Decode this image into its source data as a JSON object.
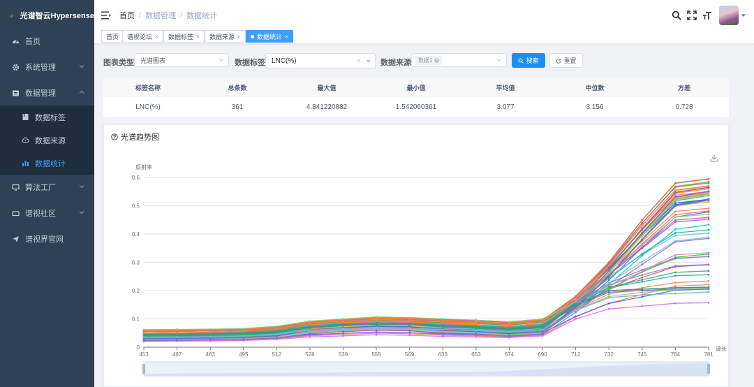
{
  "app": {
    "title": "光谱智云Hypersense"
  },
  "sidebar": {
    "items": [
      {
        "label": "首页",
        "icon": "dashboard-icon"
      },
      {
        "label": "系统管理",
        "icon": "gear-icon"
      },
      {
        "label": "数据管理",
        "icon": "database-icon"
      },
      {
        "label": "算法工厂",
        "icon": "monitor-icon"
      },
      {
        "label": "谱视社区",
        "icon": "community-icon"
      },
      {
        "label": "谱视界官网",
        "icon": "send-icon"
      }
    ],
    "sub_items": [
      {
        "label": "数据标签",
        "icon": "tag-icon"
      },
      {
        "label": "数据来源",
        "icon": "cloud-icon"
      },
      {
        "label": "数据统计",
        "icon": "bar-chart-icon"
      }
    ],
    "active_color": "#409eff",
    "bg_color": "#304156"
  },
  "header": {
    "breadcrumb": [
      "首页",
      "数据管理",
      "数据统计"
    ]
  },
  "tags": [
    {
      "label": "首页"
    },
    {
      "label": "谱视论坛"
    },
    {
      "label": "数据标签"
    },
    {
      "label": "数据来源"
    },
    {
      "label": "数据统计"
    }
  ],
  "filters": {
    "chart_type_label": "图表类型",
    "chart_type_value": "光谱图表",
    "data_tag_label": "数据标签",
    "data_tag_value": "LNC(%)",
    "data_source_label": "数据来源",
    "data_source_chip": "数据1",
    "search_label": "搜索",
    "reset_label": "重置"
  },
  "stats": {
    "headers": [
      "标签名称",
      "总条数",
      "最大值",
      "最小值",
      "平均值",
      "中位数",
      "方差"
    ],
    "row": [
      "LNC(%)",
      "361",
      "4.841220882",
      "1.542060361",
      "3.077",
      "3.156",
      "0.728"
    ]
  },
  "chart_card": {
    "title": "光谱趋势图"
  },
  "chart_data": {
    "type": "line",
    "ylabel": "反射率",
    "xlabel": "波长",
    "categories": [
      "453",
      "467",
      "483",
      "495",
      "512",
      "528",
      "539",
      "555",
      "569",
      "633",
      "653",
      "674",
      "690",
      "712",
      "732",
      "745",
      "764",
      "781"
    ],
    "y_ticks": [
      "0",
      "0.1",
      "0.2",
      "0.3",
      "0.4",
      "0.5",
      "0.6"
    ],
    "ylim": [
      0,
      0.6
    ],
    "series_count_drawn": 60,
    "series": [
      {
        "color": "#ee6666",
        "values": [
          0.055,
          0.056,
          0.058,
          0.06,
          0.068,
          0.088,
          0.095,
          0.1,
          0.098,
          0.092,
          0.088,
          0.082,
          0.095,
          0.18,
          0.3,
          0.45,
          0.58,
          0.595
        ]
      },
      {
        "color": "#fc8452",
        "values": [
          0.05,
          0.051,
          0.053,
          0.056,
          0.064,
          0.084,
          0.092,
          0.097,
          0.095,
          0.089,
          0.086,
          0.08,
          0.092,
          0.17,
          0.29,
          0.43,
          0.555,
          0.57
        ]
      },
      {
        "color": "#91cc75",
        "values": [
          0.062,
          0.063,
          0.064,
          0.066,
          0.074,
          0.092,
          0.1,
          0.107,
          0.105,
          0.1,
          0.096,
          0.09,
          0.1,
          0.16,
          0.26,
          0.36,
          0.46,
          0.47
        ]
      },
      {
        "color": "#5470c6",
        "values": [
          0.03,
          0.031,
          0.032,
          0.034,
          0.04,
          0.06,
          0.068,
          0.075,
          0.072,
          0.06,
          0.055,
          0.048,
          0.055,
          0.14,
          0.25,
          0.38,
          0.5,
          0.52
        ]
      },
      {
        "color": "#e066ff",
        "values": [
          0.02,
          0.021,
          0.022,
          0.024,
          0.028,
          0.036,
          0.04,
          0.044,
          0.042,
          0.038,
          0.036,
          0.034,
          0.04,
          0.1,
          0.135,
          0.145,
          0.155,
          0.157
        ]
      },
      {
        "color": "#3ba272",
        "values": [
          0.045,
          0.046,
          0.047,
          0.049,
          0.055,
          0.072,
          0.08,
          0.085,
          0.083,
          0.076,
          0.072,
          0.066,
          0.075,
          0.15,
          0.2,
          0.205,
          0.21,
          0.212
        ]
      },
      {
        "color": "#73c0de",
        "values": [
          0.035,
          0.036,
          0.037,
          0.039,
          0.045,
          0.06,
          0.066,
          0.07,
          0.068,
          0.062,
          0.059,
          0.054,
          0.062,
          0.13,
          0.175,
          0.185,
          0.19,
          0.195
        ]
      },
      {
        "color": "#9a60b4",
        "values": [
          0.025,
          0.026,
          0.027,
          0.028,
          0.033,
          0.048,
          0.055,
          0.06,
          0.058,
          0.05,
          0.047,
          0.04,
          0.048,
          0.14,
          0.27,
          0.4,
          0.53,
          0.55
        ]
      }
    ]
  }
}
